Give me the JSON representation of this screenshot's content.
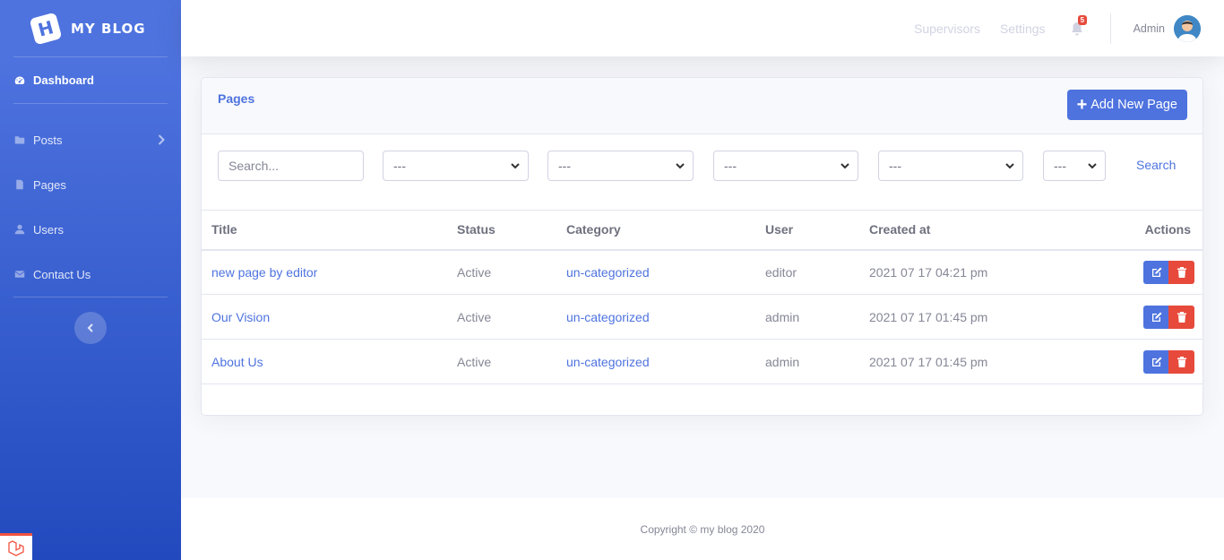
{
  "brand": {
    "logo_letter": "H",
    "name": "MY BLOG"
  },
  "sidebar": {
    "dashboard": "Dashboard",
    "items": [
      {
        "label": "Posts",
        "icon": "folder-icon",
        "has_submenu": true
      },
      {
        "label": "Pages",
        "icon": "file-icon"
      },
      {
        "label": "Users",
        "icon": "user-icon"
      },
      {
        "label": "Contact Us",
        "icon": "envelope-icon"
      }
    ],
    "toggle": "‹"
  },
  "topbar": {
    "supervisors": "Supervisors",
    "settings": "Settings",
    "notifications_count": "5",
    "admin_name": "Admin"
  },
  "card": {
    "title": "Pages",
    "add_button": "Add New Page"
  },
  "filters": {
    "search_placeholder": "Search...",
    "select1": "---",
    "select2": "---",
    "select3": "---",
    "select4": "---",
    "select5": "---",
    "search_label": "Search"
  },
  "table": {
    "headers": {
      "title": "Title",
      "status": "Status",
      "category": "Category",
      "user": "User",
      "created_at": "Created at",
      "actions": "Actions"
    },
    "rows": [
      {
        "title": "new page by editor",
        "status": "Active",
        "category": "un-categorized",
        "user": "editor",
        "created_at": "2021 07 17 04:21 pm"
      },
      {
        "title": "Our Vision",
        "status": "Active",
        "category": "un-categorized",
        "user": "admin",
        "created_at": "2021 07 17 01:45 pm"
      },
      {
        "title": "About Us",
        "status": "Active",
        "category": "un-categorized",
        "user": "admin",
        "created_at": "2021 07 17 01:45 pm"
      }
    ]
  },
  "footer": {
    "text": "Copyright © my blog 2020"
  },
  "colors": {
    "primary": "#4e73df",
    "danger": "#e74a3b",
    "sidebar_end": "#224abe"
  }
}
